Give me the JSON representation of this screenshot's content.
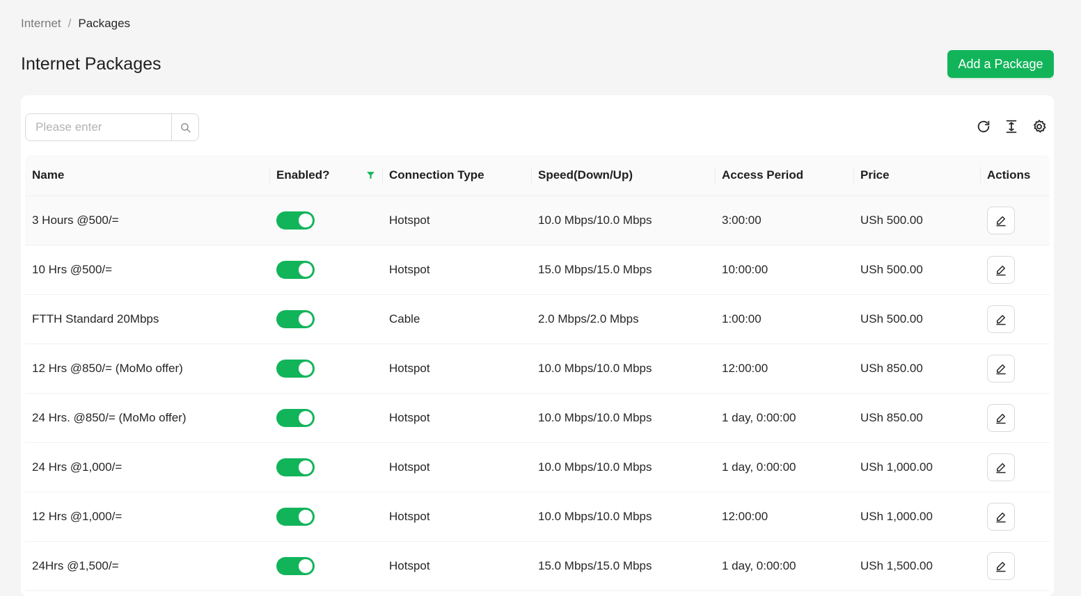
{
  "breadcrumb": {
    "items": [
      "Internet",
      "Packages"
    ],
    "separator": "/"
  },
  "page": {
    "title": "Internet Packages",
    "add_button_label": "Add a Package"
  },
  "search": {
    "placeholder": "Please enter",
    "value": ""
  },
  "toolbar": {
    "icons": [
      "reload-icon",
      "column-height-icon",
      "settings-icon"
    ]
  },
  "table": {
    "columns": [
      "Name",
      "Enabled?",
      "Connection Type",
      "Speed(Down/Up)",
      "Access Period",
      "Price",
      "Actions"
    ],
    "rows": [
      {
        "name": "3 Hours @500/=",
        "enabled": true,
        "connection_type": "Hotspot",
        "speed": "10.0 Mbps/10.0 Mbps",
        "access_period": "3:00:00",
        "price": "USh 500.00"
      },
      {
        "name": "10 Hrs @500/=",
        "enabled": true,
        "connection_type": "Hotspot",
        "speed": "15.0 Mbps/15.0 Mbps",
        "access_period": "10:00:00",
        "price": "USh 500.00"
      },
      {
        "name": "FTTH Standard 20Mbps",
        "enabled": true,
        "connection_type": "Cable",
        "speed": "2.0 Mbps/2.0 Mbps",
        "access_period": "1:00:00",
        "price": "USh 500.00"
      },
      {
        "name": "12 Hrs @850/= (MoMo offer)",
        "enabled": true,
        "connection_type": "Hotspot",
        "speed": "10.0 Mbps/10.0 Mbps",
        "access_period": "12:00:00",
        "price": "USh 850.00"
      },
      {
        "name": "24 Hrs. @850/= (MoMo offer)",
        "enabled": true,
        "connection_type": "Hotspot",
        "speed": "10.0 Mbps/10.0 Mbps",
        "access_period": "1 day, 0:00:00",
        "price": "USh 850.00"
      },
      {
        "name": "24 Hrs @1,000/=",
        "enabled": true,
        "connection_type": "Hotspot",
        "speed": "10.0 Mbps/10.0 Mbps",
        "access_period": "1 day, 0:00:00",
        "price": "USh 1,000.00"
      },
      {
        "name": "12 Hrs @1,000/=",
        "enabled": true,
        "connection_type": "Hotspot",
        "speed": "10.0 Mbps/10.0 Mbps",
        "access_period": "12:00:00",
        "price": "USh 1,000.00"
      },
      {
        "name": "24Hrs @1,500/=",
        "enabled": true,
        "connection_type": "Hotspot",
        "speed": "15.0 Mbps/15.0 Mbps",
        "access_period": "1 day, 0:00:00",
        "price": "USh 1,500.00"
      }
    ]
  },
  "colors": {
    "accent": "#12b45a",
    "background": "#f5f5f5",
    "card": "#ffffff"
  }
}
